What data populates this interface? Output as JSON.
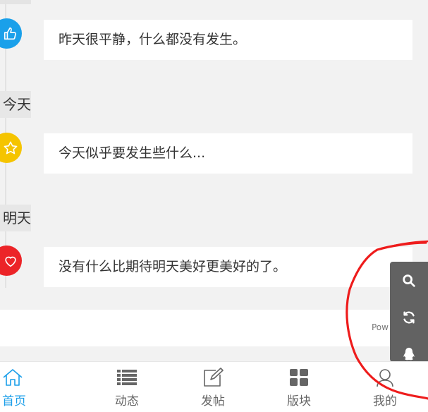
{
  "timeline": [
    {
      "day_label": "",
      "text": "昨天很平静，什么都没有发生。",
      "icon": "thumbs-up-icon",
      "color": "#1aa0ea"
    },
    {
      "day_label": "今天",
      "text": "今天似乎要发生些什么...",
      "icon": "star-icon",
      "color": "#f5c400"
    },
    {
      "day_label": "明天",
      "text": "没有什么比期待明天美好更美好的了。",
      "icon": "heart-icon",
      "color": "#ec2428"
    }
  ],
  "footer": {
    "powered_text": "Pow"
  },
  "side_tools": [
    {
      "icon": "search-icon"
    },
    {
      "icon": "refresh-icon"
    },
    {
      "icon": "qq-penguin-icon"
    }
  ],
  "tabbar": {
    "items": [
      {
        "label": "首页",
        "icon": "home-icon",
        "active": true
      },
      {
        "label": "动态",
        "icon": "list-icon",
        "active": false
      },
      {
        "label": "发帖",
        "icon": "compose-icon",
        "active": false
      },
      {
        "label": "版块",
        "icon": "grid-icon",
        "active": false
      },
      {
        "label": "我的",
        "icon": "user-icon",
        "active": false
      }
    ]
  },
  "colors": {
    "accent": "#1a9ee9",
    "annotation": "#ee1c1c"
  }
}
